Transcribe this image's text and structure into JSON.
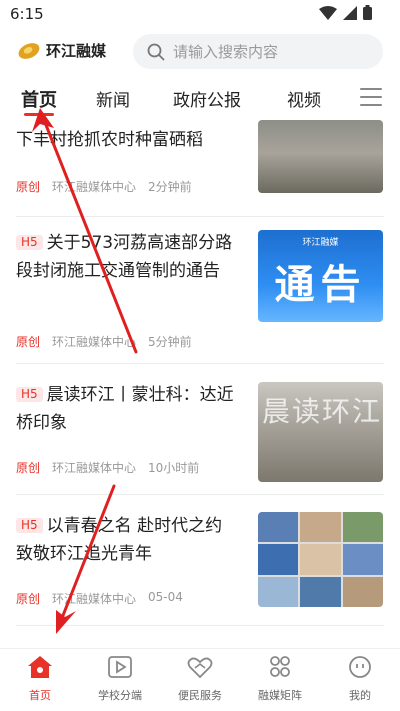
{
  "status": {
    "time": "6:15"
  },
  "header": {
    "logo_text": "环江融媒",
    "search_placeholder": "请输入搜索内容"
  },
  "tabs": [
    {
      "label": "首页",
      "active": true
    },
    {
      "label": "新闻"
    },
    {
      "label": "政府公报"
    },
    {
      "label": "视频"
    }
  ],
  "feed": [
    {
      "title_partial": "下丰村抢抓农时种富硒稻",
      "tag": "原创",
      "source": "环江融媒体中心",
      "time": "2分钟前",
      "thumb": "farm-photo"
    },
    {
      "badge": "H5",
      "title": "关于573河荔高速部分路段封闭施工交通管制的通告",
      "tag": "原创",
      "source": "环江融媒体中心",
      "time": "5分钟前",
      "thumb_text": "通告",
      "thumb_logo": "环江融媒"
    },
    {
      "badge": "H5",
      "title": "晨读环江丨蒙壮科：达近桥印象",
      "tag": "原创",
      "source": "环江融媒体中心",
      "time": "10小时前",
      "thumb_text": "晨读环江"
    },
    {
      "badge": "H5",
      "title": "以青春之名 赴时代之约 致敬环江追光青年",
      "tag": "原创",
      "source": "环江融媒体中心",
      "time": "05-04",
      "thumb": "collage-photo"
    }
  ],
  "bottom_nav": [
    {
      "label": "首页",
      "icon": "home-icon",
      "active": true
    },
    {
      "label": "学校分端",
      "icon": "play-icon"
    },
    {
      "label": "便民服务",
      "icon": "heart-hands-icon"
    },
    {
      "label": "融媒矩阵",
      "icon": "grid-icon"
    },
    {
      "label": "我的",
      "icon": "smile-icon"
    }
  ],
  "colors": {
    "accent": "#e83227",
    "annotation": "#e02020"
  }
}
